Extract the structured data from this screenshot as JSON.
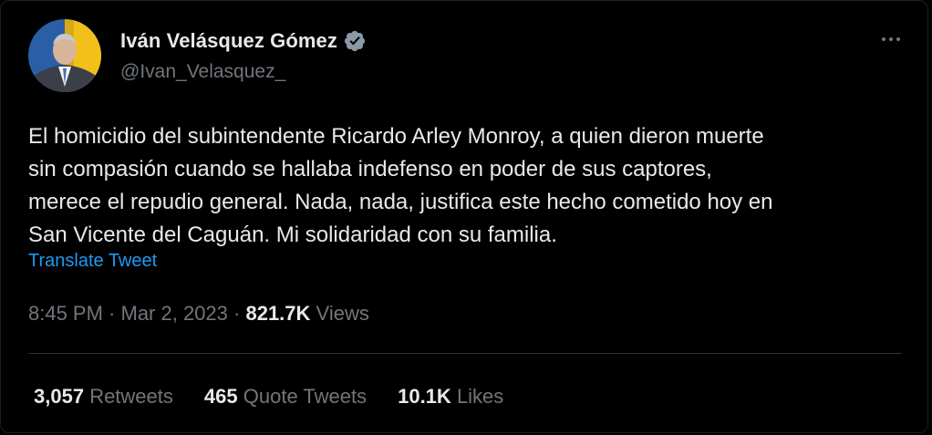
{
  "author": {
    "display_name": "Iván Velásquez Gómez",
    "handle": "@Ivan_Velasquez_",
    "verified_icon": "verified-badge-icon",
    "verified_color": "#1d9bf0"
  },
  "tweet": {
    "text": "El homicidio del subintendente Ricardo Arley Monroy, a quien dieron muerte\nsin compasión cuando se hallaba indefenso en poder de sus captores,\nmerece el repudio general. Nada, nada, justifica este hecho cometido hoy en\nSan Vicente del Caguán. Mi solidaridad con su familia.",
    "translate_label": "Translate Tweet",
    "time": "8:45 PM",
    "separator": " · ",
    "date": "Mar 2, 2023",
    "views_count": "821.7K",
    "views_label": "Views"
  },
  "stats": {
    "retweets_count": "3,057",
    "retweets_label": "Retweets",
    "quotes_count": "465",
    "quotes_label": "Quote Tweets",
    "likes_count": "10.1K",
    "likes_label": "Likes"
  },
  "icons": {
    "more": "more-options-icon"
  },
  "colors": {
    "background": "#000000",
    "text": "#e7e9ea",
    "secondary": "#71767b",
    "link": "#1d9bf0",
    "divider": "#2f3336"
  }
}
